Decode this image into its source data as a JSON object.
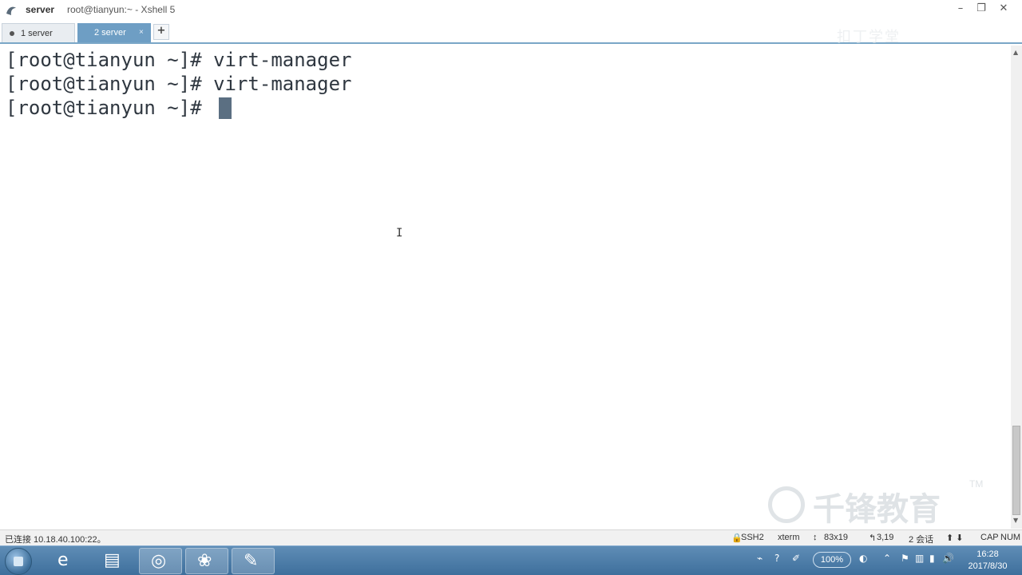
{
  "window": {
    "session_name": "server",
    "title": "root@tianyun:~ - Xshell 5",
    "controls": {
      "minimize": "–",
      "maximize": "❐",
      "close": "✕"
    }
  },
  "tabs": {
    "items": [
      {
        "label": "1 server",
        "active": false
      },
      {
        "label": "2 server",
        "active": true,
        "close": "×"
      }
    ],
    "add_label": "+"
  },
  "terminal": {
    "lines": [
      "[root@tianyun ~]# virt-manager",
      "[root@tianyun ~]# virt-manager",
      "[root@tianyun ~]# "
    ],
    "mouse_cursor": "I"
  },
  "watermark": {
    "text": "千锋教育",
    "tm": "TM",
    "faint_logo": "扣丁学堂"
  },
  "statusbar": {
    "connection": "已连接 10.18.40.100:22。",
    "protocol": "SSH2",
    "terminal_type": "xterm",
    "size": "83x19",
    "position": "3,19",
    "sessions": "2 会话",
    "arrows": "⬆ ⬇",
    "cap": "CAP",
    "num": "NUM"
  },
  "taskbar": {
    "apps": [
      "ie-icon",
      "files-icon",
      "xshell-icon",
      "cherry-icon",
      "paint-icon"
    ],
    "zoom": "100%",
    "tray_help": "?",
    "time": "16:28",
    "date": "2017/8/30"
  }
}
